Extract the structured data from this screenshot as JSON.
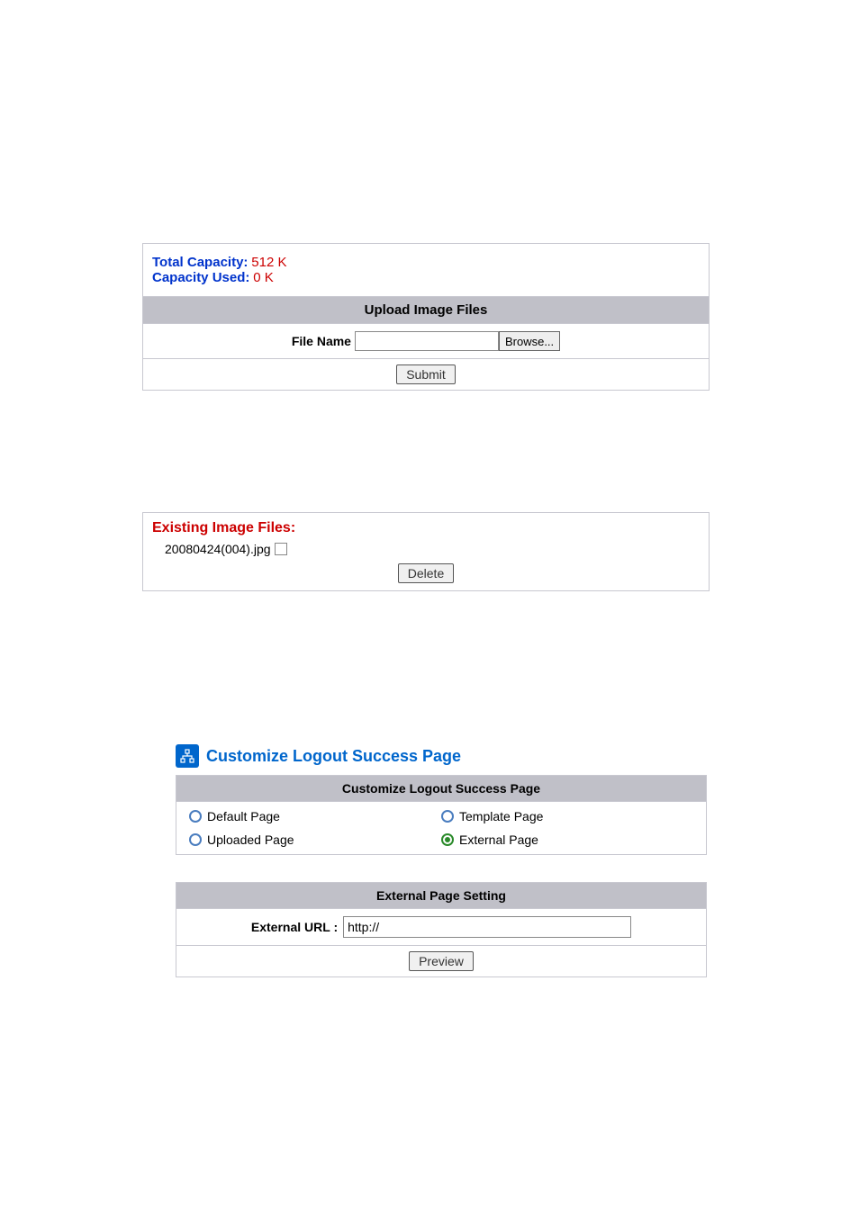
{
  "capacity": {
    "total_label": "Total Capacity:",
    "total_value": "512 K",
    "used_label": "Capacity Used:",
    "used_value": "0 K"
  },
  "upload": {
    "header": "Upload Image Files",
    "file_name_label": "File Name",
    "browse_label": "Browse...",
    "submit_label": "Submit"
  },
  "existing": {
    "title": "Existing Image Files:",
    "file": "20080424(004).jpg",
    "delete_label": "Delete"
  },
  "customize": {
    "section_title": "Customize Logout Success Page",
    "header": "Customize Logout Success Page",
    "options": {
      "default": "Default Page",
      "template": "Template Page",
      "uploaded": "Uploaded Page",
      "external": "External Page"
    }
  },
  "external": {
    "header": "External Page Setting",
    "url_label": "External URL :",
    "url_value": "http://",
    "preview_label": "Preview"
  }
}
